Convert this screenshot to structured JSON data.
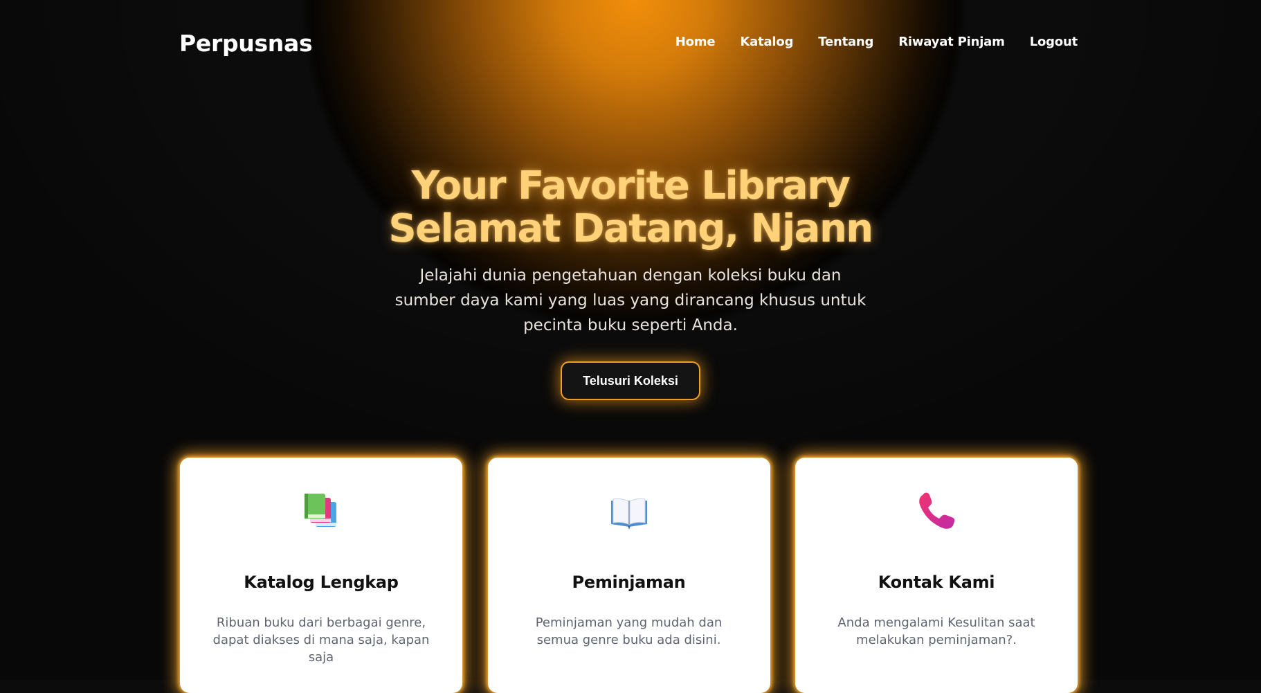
{
  "brand": "Perpusnas",
  "nav": {
    "items": [
      "Home",
      "Katalog",
      "Tentang",
      "Riwayat Pinjam",
      "Logout"
    ]
  },
  "hero": {
    "title_line1": "Your Favorite Library",
    "title_line2": "Selamat Datang, Njann",
    "subtitle": "Jelajahi dunia pengetahuan dengan koleksi buku dan sumber daya kami yang luas yang dirancang khusus untuk pecinta buku seperti Anda.",
    "cta_label": "Telusuri Koleksi"
  },
  "features": [
    {
      "icon": "books-icon",
      "title": "Katalog Lengkap",
      "description": "Ribuan buku dari berbagai genre, dapat diakses di mana saja, kapan saja"
    },
    {
      "icon": "open-book-icon",
      "title": "Peminjaman",
      "description": "Peminjaman yang mudah dan semua genre buku ada disini."
    },
    {
      "icon": "telephone-icon",
      "title": "Kontak Kami",
      "description": "Anda mengalami Kesulitan saat melakukan peminjaman?."
    }
  ],
  "colors": {
    "background": "#0c0c0c",
    "glow": "#f28f0a",
    "title": "#ffd27a",
    "card": "#ffffff",
    "card_glow": "#ffaa28"
  }
}
